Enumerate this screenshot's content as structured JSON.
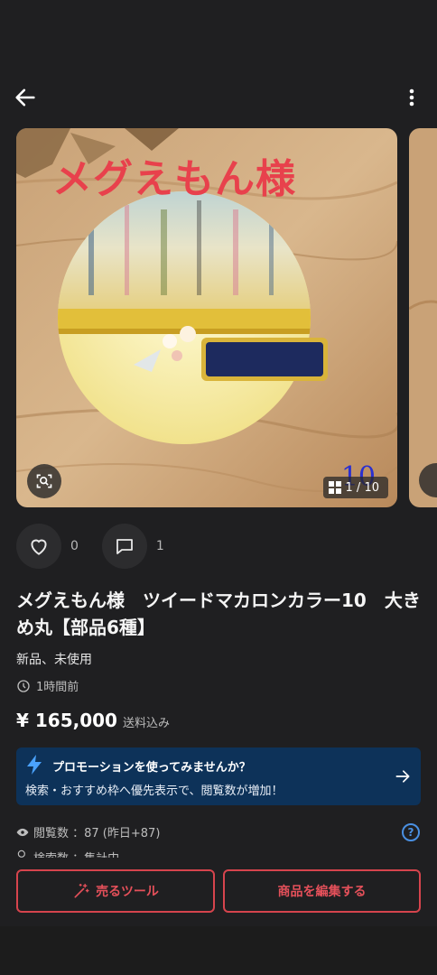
{
  "header": {
    "back_icon": "arrow-left-icon",
    "menu_icon": "more-vertical-icon"
  },
  "gallery": {
    "overlay_text": "メグえもん様",
    "handwritten_number": "10",
    "counter": "1 / 10",
    "counter_icon": "grid-icon",
    "lens_icon": "image-search-icon"
  },
  "actions": {
    "like_count": "0",
    "comment_count": "1",
    "like_icon": "heart-icon",
    "comment_icon": "comment-icon"
  },
  "item": {
    "title": "メグえもん様　ツイードマカロンカラー10　大きめ丸【部品6種】",
    "condition": "新品、未使用",
    "posted": "1時間前",
    "price": "¥ 165,000",
    "shipping": "送料込み"
  },
  "promo": {
    "title": "プロモーションを使ってみませんか？",
    "subtitle": "検索・おすすめ枠へ優先表示で、閲覧数が増加！",
    "accent": "#0d3259"
  },
  "stats": {
    "views": "閲覧数 ：87 (昨日+87)",
    "searches": "検索数 ：集計中",
    "help": "?"
  },
  "buttons": {
    "tools_label": "売るツール",
    "edit_label": "商品を編集する",
    "accent": "#d6444d"
  }
}
